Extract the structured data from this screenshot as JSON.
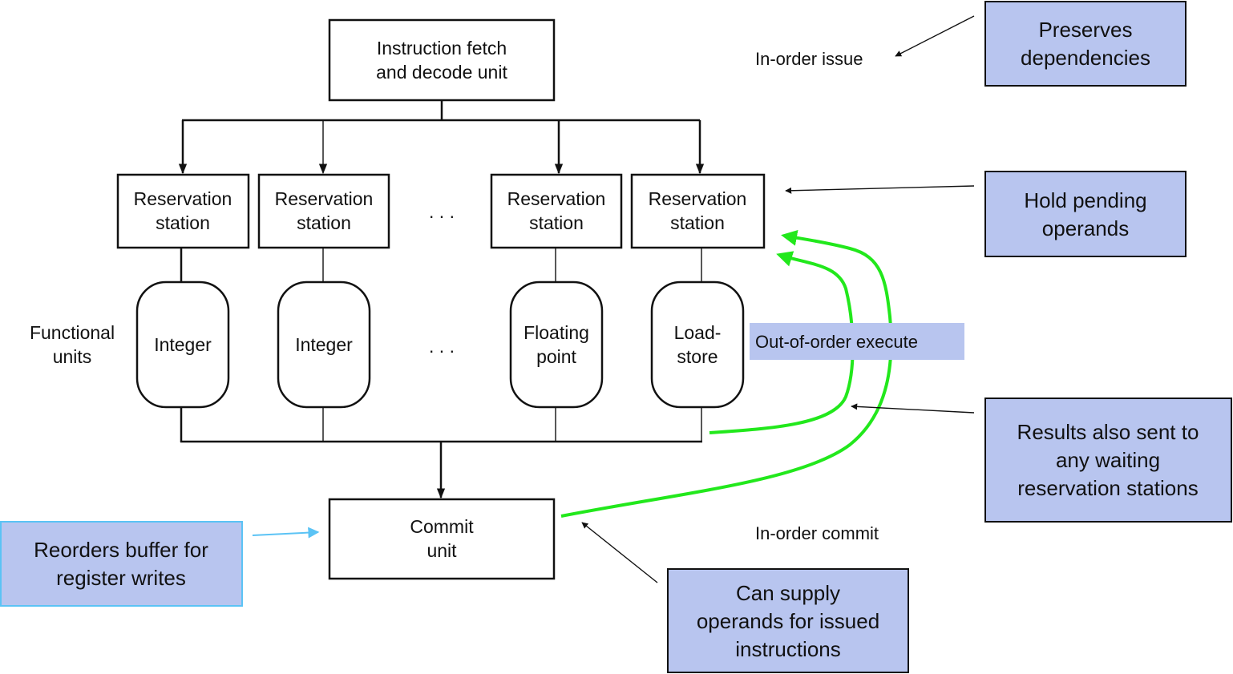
{
  "diagram": {
    "units": {
      "fetch_decode": [
        "Instruction fetch",
        "and decode unit"
      ],
      "reservation_stations": [
        [
          "Reservation",
          "station"
        ],
        [
          "Reservation",
          "station"
        ],
        [
          "Reservation",
          "station"
        ],
        [
          "Reservation",
          "station"
        ]
      ],
      "ellipsis": ". . .",
      "functional_units_label": [
        "Functional",
        "units"
      ],
      "functional_units": [
        [
          "Integer"
        ],
        [
          "Integer"
        ],
        [
          "Floating",
          "point"
        ],
        [
          "Load-",
          "store"
        ]
      ],
      "commit": [
        "Commit",
        "unit"
      ]
    },
    "stage_labels": {
      "issue": "In-order issue",
      "execute": "Out-of-order execute",
      "commit": "In-order commit"
    },
    "annotations": {
      "preserves": [
        "Preserves",
        "dependencies"
      ],
      "hold": [
        "Hold pending",
        "operands"
      ],
      "results": [
        "Results also sent to",
        "any waiting",
        "reservation stations"
      ],
      "reorders": [
        "Reorders buffer for",
        "register writes"
      ],
      "supply": [
        "Can supply",
        "operands for issued",
        "instructions"
      ]
    },
    "colors": {
      "note_fill": "#b8c5ef",
      "forward_path": "#22e81c",
      "reorder_arrow": "#5bc3f5"
    }
  }
}
